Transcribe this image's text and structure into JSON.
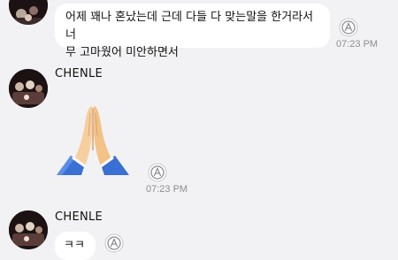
{
  "messages": [
    {
      "text_line1": "어제 꽤나 혼났는데 근데 다들 다 맞는말을 한거라서 너",
      "text_line2": "무 고마웠어 미안하면서",
      "time": "07:23 PM"
    },
    {
      "sender": "CHENLE",
      "emoji": "folded-hands",
      "time": "07:23 PM"
    },
    {
      "sender": "CHENLE",
      "text": "ㅋㅋ"
    }
  ],
  "icons": {
    "avatar": "profile-photo",
    "reaction": "reaction-add-icon"
  },
  "colors": {
    "background": "#f2f2f4",
    "bubble": "#ffffff",
    "time": "#8e8e93"
  }
}
